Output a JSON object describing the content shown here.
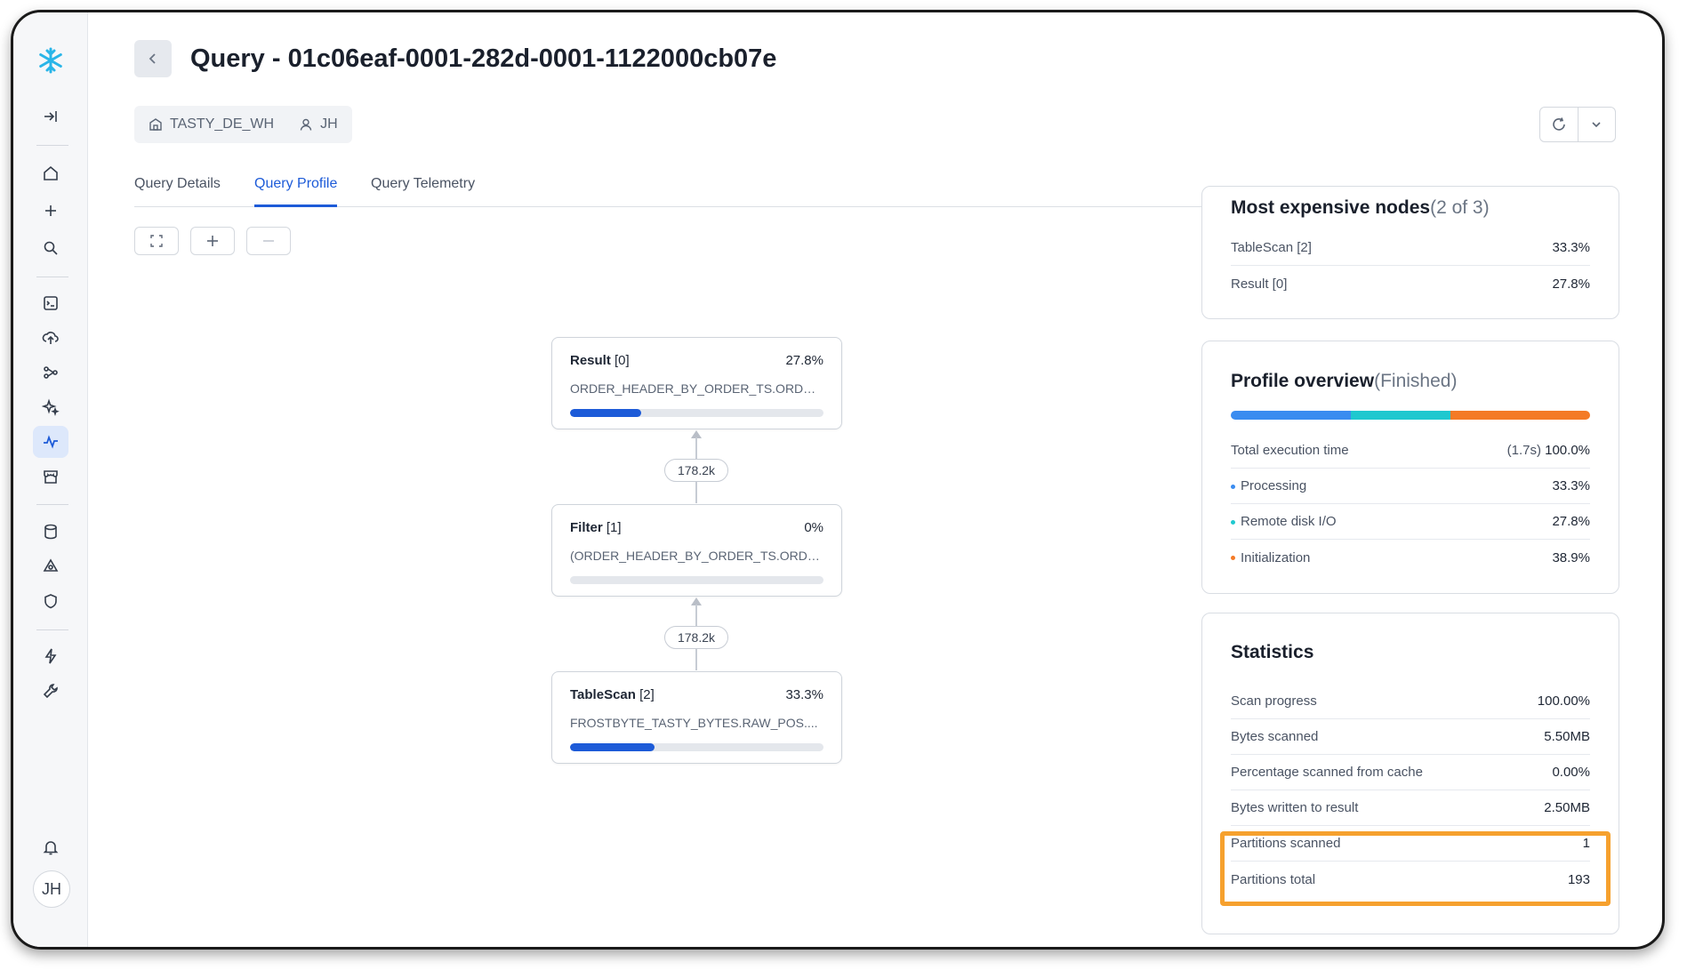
{
  "header": {
    "title": "Query - 01c06eaf-0001-282d-0001-1122000cb07e",
    "warehouse": "TASTY_DE_WH",
    "user": "JH"
  },
  "tabs": [
    {
      "label": "Query Details"
    },
    {
      "label": "Query Profile"
    },
    {
      "label": "Query Telemetry"
    }
  ],
  "sidebar": {
    "avatar": "JH"
  },
  "graph": {
    "nodes": [
      {
        "name": "Result",
        "id": "[0]",
        "pct": "27.8%",
        "sub": "ORDER_HEADER_BY_ORDER_TS.ORDER...",
        "progress": 0.28
      },
      {
        "name": "Filter",
        "id": "[1]",
        "pct": "0%",
        "sub": "(ORDER_HEADER_BY_ORDER_TS.ORDER...",
        "progress": 0
      },
      {
        "name": "TableScan",
        "id": "[2]",
        "pct": "33.3%",
        "sub": "FROSTBYTE_TASTY_BYTES.RAW_POS....",
        "progress": 0.333
      }
    ],
    "edges": [
      "178.2k",
      "178.2k"
    ]
  },
  "expensive": {
    "title": "Most expensive nodes",
    "count": "(2 of 3)",
    "rows": [
      {
        "label": "TableScan [2]",
        "value": "33.3%"
      },
      {
        "label": "Result [0]",
        "value": "27.8%"
      }
    ]
  },
  "overview": {
    "title": "Profile overview",
    "status": "(Finished)",
    "total_label": "Total execution time",
    "total_time": "(1.7s)",
    "total_pct": "100.0%",
    "segments": [
      {
        "label": "Processing",
        "value": "33.3%",
        "fraction": 0.333,
        "color": "#3a8cf0"
      },
      {
        "label": "Remote disk I/O",
        "value": "27.8%",
        "fraction": 0.278,
        "color": "#1fc8cf"
      },
      {
        "label": "Initialization",
        "value": "38.9%",
        "fraction": 0.389,
        "color": "#f47a26"
      }
    ]
  },
  "statistics": {
    "title": "Statistics",
    "rows": [
      {
        "label": "Scan progress",
        "value": "100.00%"
      },
      {
        "label": "Bytes scanned",
        "value": "5.50MB"
      },
      {
        "label": "Percentage scanned from cache",
        "value": "0.00%"
      },
      {
        "label": "Bytes written to result",
        "value": "2.50MB"
      },
      {
        "label": "Partitions scanned",
        "value": "1"
      },
      {
        "label": "Partitions total",
        "value": "193"
      }
    ]
  },
  "colors": {
    "accent": "#1d5bd8",
    "highlight": "#f6a12e"
  }
}
